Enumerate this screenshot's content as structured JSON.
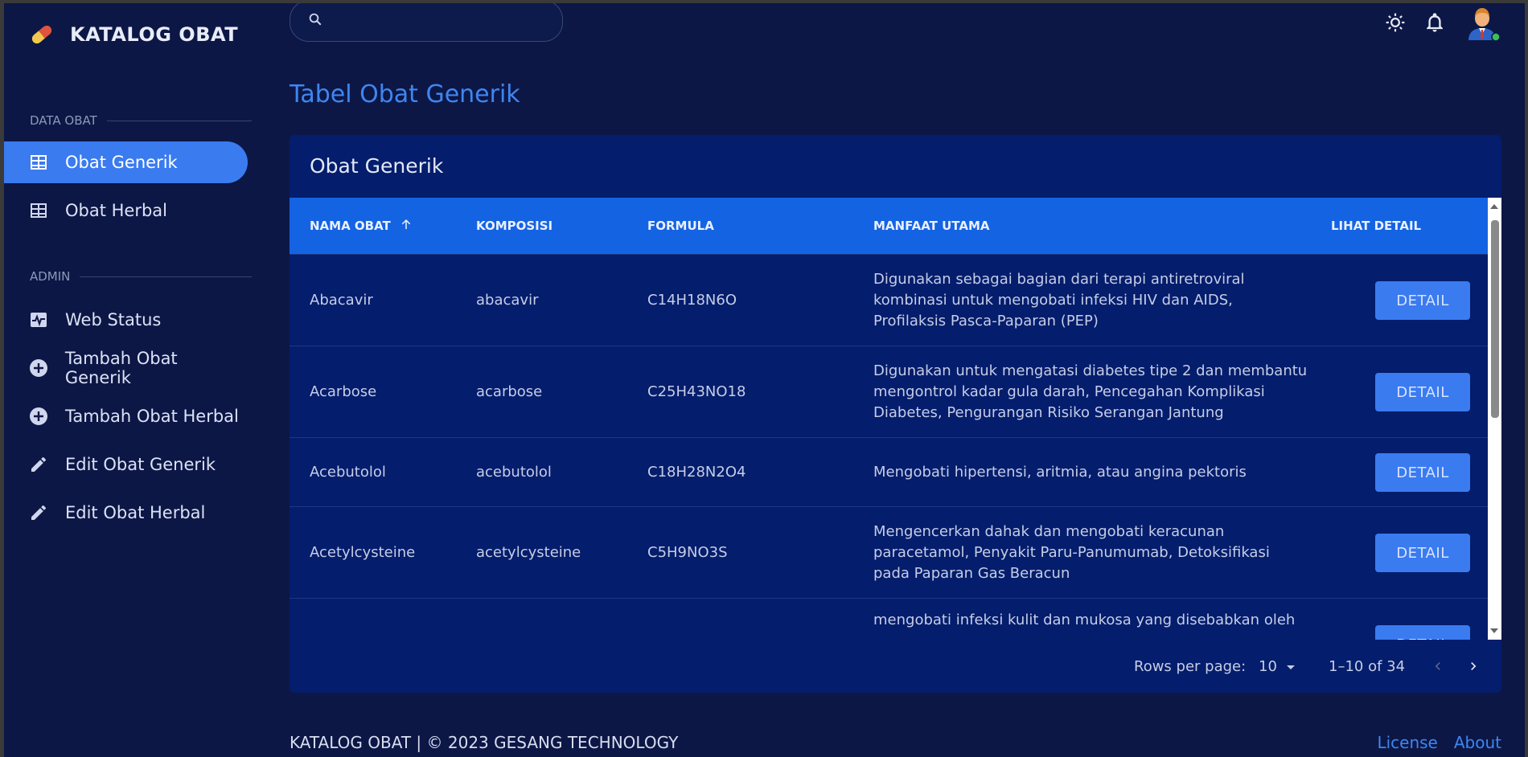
{
  "app": {
    "title": "KATALOG OBAT"
  },
  "search": {
    "placeholder": ""
  },
  "sidebar": {
    "sections": [
      {
        "label": "DATA OBAT"
      },
      {
        "label": "ADMIN"
      }
    ],
    "items": [
      {
        "label": "Obat Generik",
        "icon": "table-icon",
        "active": true
      },
      {
        "label": "Obat Herbal",
        "icon": "table-icon",
        "active": false
      },
      {
        "label": "Web Status",
        "icon": "pulse-icon",
        "active": false
      },
      {
        "label": "Tambah Obat Generik",
        "icon": "add-circle-icon",
        "active": false
      },
      {
        "label": "Tambah Obat Herbal",
        "icon": "add-circle-icon",
        "active": false
      },
      {
        "label": "Edit Obat Generik",
        "icon": "pencil-icon",
        "active": false
      },
      {
        "label": "Edit Obat Herbal",
        "icon": "pencil-icon",
        "active": false
      }
    ]
  },
  "page": {
    "title": "Tabel Obat Generik"
  },
  "card": {
    "title": "Obat Generik"
  },
  "table": {
    "columns": [
      "NAMA OBAT",
      "KOMPOSISI",
      "FORMULA",
      "MANFAAT UTAMA",
      "LIHAT DETAIL"
    ],
    "sort_column": "NAMA OBAT",
    "sort_direction": "ascending",
    "button_label": "DETAIL",
    "rows": [
      {
        "name": "Abacavir",
        "composition": "abacavir",
        "formula": "C14H18N6O",
        "benefit": "Digunakan sebagai bagian dari terapi antiretroviral kombinasi untuk mengobati infeksi HIV dan AIDS, Profilaksis Pasca-Paparan (PEP)"
      },
      {
        "name": "Acarbose",
        "composition": "acarbose",
        "formula": "C25H43NO18",
        "benefit": "Digunakan untuk mengatasi diabetes tipe 2 dan membantu mengontrol kadar gula darah, Pencegahan Komplikasi Diabetes, Pengurangan Risiko Serangan Jantung"
      },
      {
        "name": "Acebutolol",
        "composition": "acebutolol",
        "formula": "C18H28N2O4",
        "benefit": "Mengobati hipertensi, aritmia, atau angina pektoris"
      },
      {
        "name": "Acetylcysteine",
        "composition": "acetylcysteine",
        "formula": "C5H9NO3S",
        "benefit": "Mengencerkan dahak dan mengobati keracunan paracetamol, Penyakit Paru-Panumumab, Detoksifikasi pada Paparan Gas Beracun"
      },
      {
        "name": "",
        "composition": "",
        "formula": "",
        "benefit": "mengobati infeksi kulit dan mukosa yang disebabkan oleh"
      }
    ]
  },
  "pagination": {
    "rows_per_page_label": "Rows per page:",
    "rows_per_page": "10",
    "range": "1–10 of 34"
  },
  "footer": {
    "text": "KATALOG OBAT | © 2023 GESANG TECHNOLOGY",
    "links": [
      "License",
      "About"
    ]
  },
  "colors": {
    "background": "#0c1746",
    "card": "#041d6c",
    "header": "#1463e3",
    "accent": "#3a7bf0",
    "title": "#3f86f0"
  }
}
